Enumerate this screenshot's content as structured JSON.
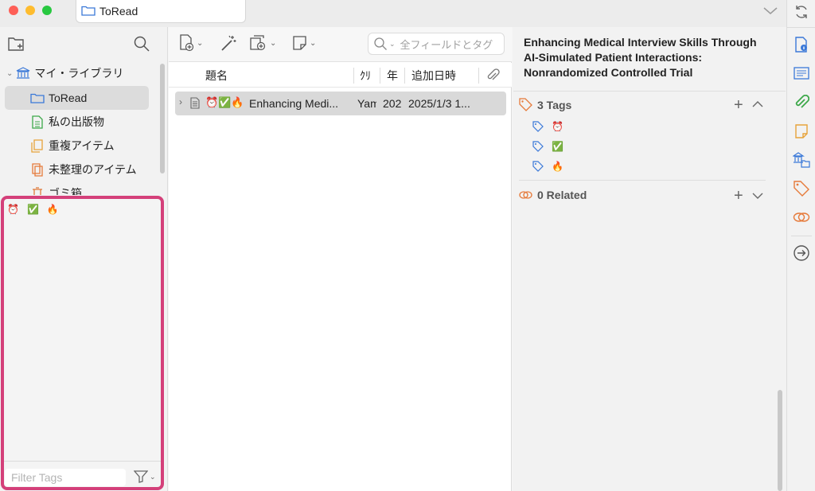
{
  "window": {
    "tab_label": "ToRead",
    "traffic_colors": [
      "#fe5f57",
      "#febc2e",
      "#28c840"
    ]
  },
  "library": {
    "root_label": "マイ・ライブラリ",
    "items": [
      {
        "label": "ToRead",
        "icon": "folder-icon"
      },
      {
        "label": "私の出版物",
        "icon": "document-icon"
      },
      {
        "label": "重複アイテム",
        "icon": "duplicate-icon"
      },
      {
        "label": "未整理のアイテム",
        "icon": "unfiled-icon"
      },
      {
        "label": "ゴミ箱",
        "icon": "trash-icon"
      }
    ]
  },
  "tag_selector": {
    "tags": [
      "⏰",
      "✅",
      "🔥"
    ],
    "filter_placeholder": "Filter Tags"
  },
  "toolbar": {
    "search_placeholder": "全フィールドとタグ"
  },
  "columns": {
    "title": "題名",
    "creator": "ｸﾘ",
    "year": "年",
    "date_added": "追加日時"
  },
  "items": [
    {
      "emojis": "⏰✅🔥",
      "title": "Enhancing Medi...",
      "creator": "Yam",
      "year": "202",
      "date_added": "2025/1/3 1..."
    }
  ],
  "detail": {
    "title": "Enhancing Medical Interview Skills Through AI-Simulated Patient Interactions: Nonrandomized Controlled Trial",
    "tags_header": "3 Tags",
    "tags": [
      "⏰",
      "✅",
      "🔥"
    ],
    "related_header": "0 Related"
  }
}
